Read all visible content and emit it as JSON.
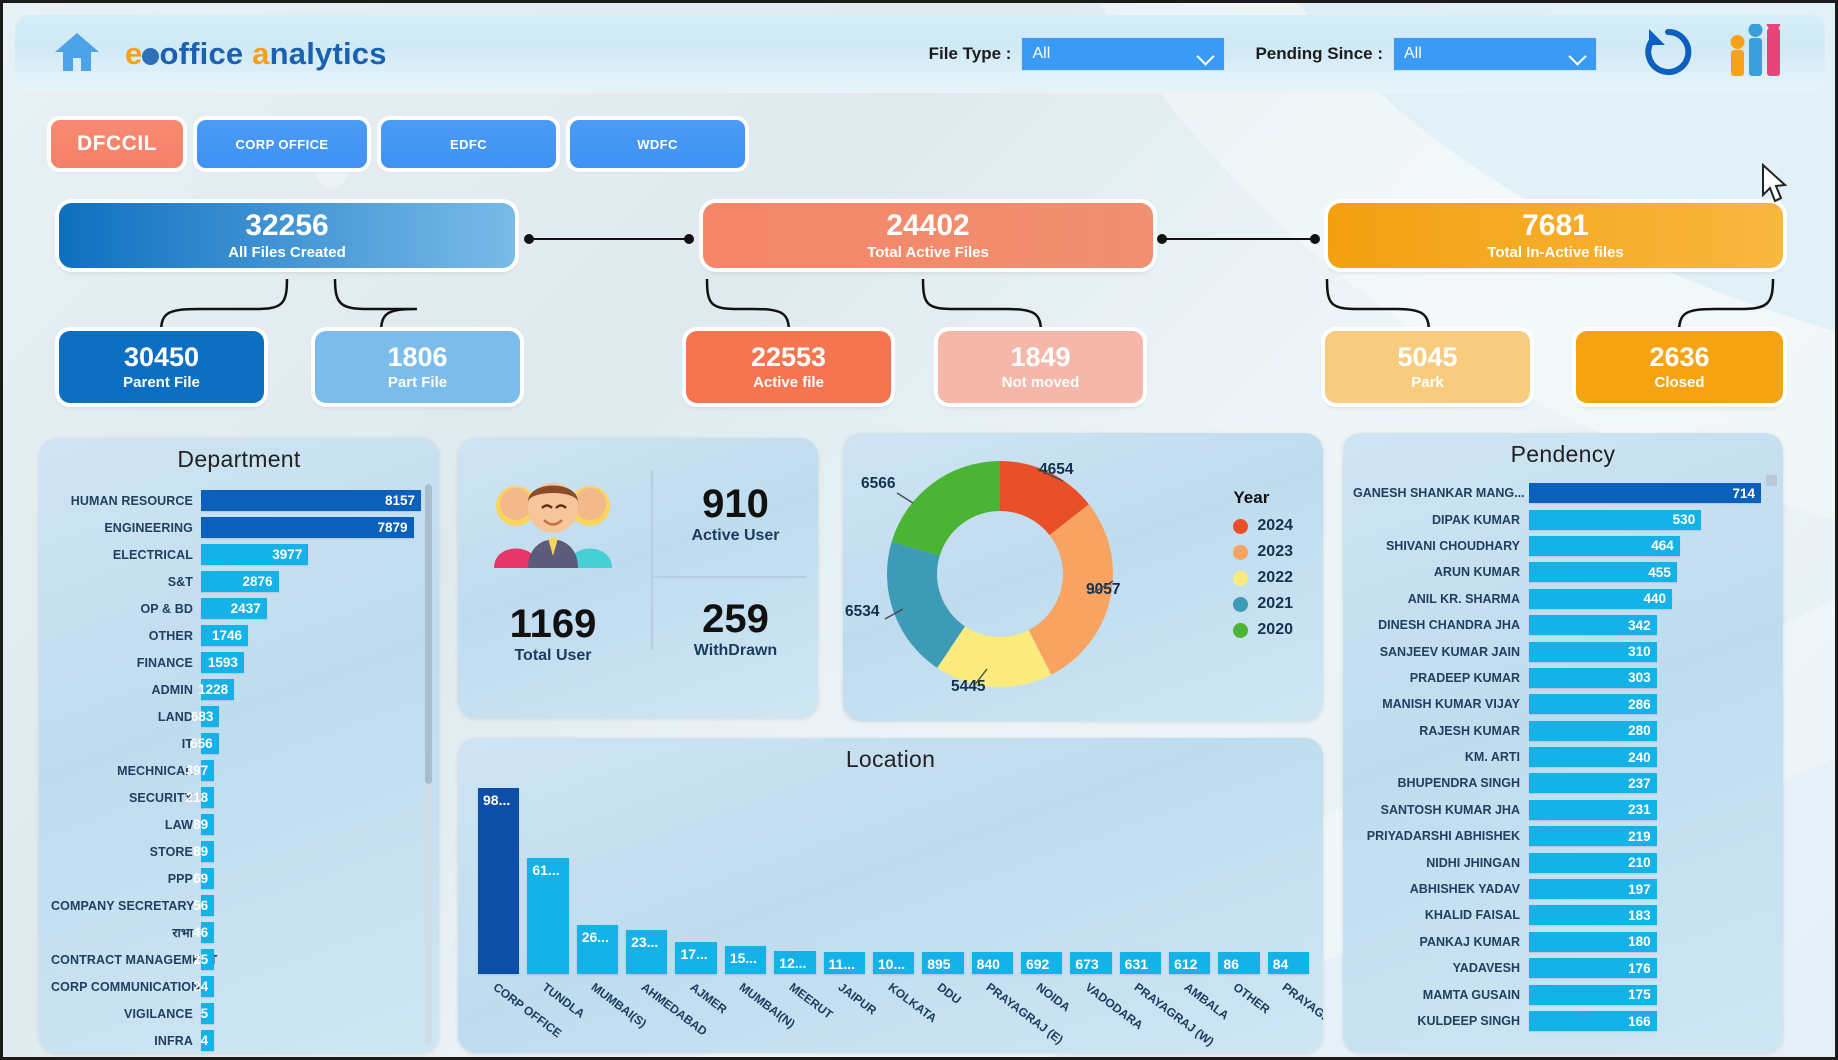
{
  "header": {
    "brand_e": "e",
    "brand_office": "office",
    "brand_a": "a",
    "brand_nalytics": "nalytics",
    "file_type_label": "File Type :",
    "file_type_value": "All",
    "pending_since_label": "Pending Since :",
    "pending_since_value": "All",
    "home_icon": "home-icon",
    "refresh_icon": "refresh-icon",
    "logo_icon": "people-chart-logo"
  },
  "tabs": [
    {
      "label": "DFCCIL",
      "active": true
    },
    {
      "label": "CORP OFFICE",
      "active": false
    },
    {
      "label": "EDFC",
      "active": false
    },
    {
      "label": "WDFC",
      "active": false
    }
  ],
  "kpi_top": [
    {
      "value": "32256",
      "label": "All Files Created"
    },
    {
      "value": "24402",
      "label": "Total Active Files"
    },
    {
      "value": "7681",
      "label": "Total In-Active files"
    }
  ],
  "kpi_sub": [
    {
      "value": "30450",
      "label": "Parent File"
    },
    {
      "value": "1806",
      "label": "Part File"
    },
    {
      "value": "22553",
      "label": "Active file"
    },
    {
      "value": "1849",
      "label": "Not moved"
    },
    {
      "value": "5045",
      "label": "Park"
    },
    {
      "value": "2636",
      "label": "Closed"
    }
  ],
  "department": {
    "title": "Department",
    "chart_data": {
      "type": "bar",
      "title": "Department",
      "orientation": "horizontal",
      "categories": [
        "HUMAN RESOURCE",
        "ENGINEERING",
        "ELECTRICAL",
        "S&T",
        "OP & BD",
        "OTHER",
        "FINANCE",
        "ADMIN",
        "LAND",
        "IT",
        "MECHNICAL",
        "SECURITY",
        "LAW",
        "STORE",
        "PPP",
        "COMPANY SECRETARY",
        "राभा",
        "CONTRACT MANAGEMENT",
        "CORP COMMUNICATION",
        "VIGILANCE",
        "INFRA"
      ],
      "values": [
        8157,
        7879,
        3977,
        2876,
        2437,
        1746,
        1593,
        1228,
        683,
        656,
        397,
        218,
        89,
        89,
        69,
        56,
        46,
        25,
        24,
        5,
        4
      ],
      "xlabel": "",
      "ylabel": "",
      "grid": false,
      "legend": "none"
    }
  },
  "users": {
    "active_user_value": "910",
    "active_user_label": "Active User",
    "total_user_value": "1169",
    "total_user_label": "Total User",
    "withdrawn_value": "259",
    "withdrawn_label": "WithDrawn",
    "avatar_icon": "users-group-icon"
  },
  "donut": {
    "legend_title": "Year",
    "chart_data": {
      "type": "pie",
      "title": "",
      "categories": [
        "2024",
        "2023",
        "2022",
        "2021",
        "2020"
      ],
      "values": [
        4654,
        9057,
        5445,
        6534,
        6566
      ],
      "colors": [
        "#e8502a",
        "#f9a362",
        "#fbeb7d",
        "#3d9bb5",
        "#4bb434"
      ],
      "labels": [
        "4654",
        "9057",
        "5445",
        "6534",
        "6566"
      ],
      "legend": "right",
      "total": 32256
    }
  },
  "location": {
    "title": "Location",
    "chart_data": {
      "type": "bar",
      "title": "Location",
      "orientation": "vertical",
      "categories": [
        "CORP OFFICE",
        "TUNDLA",
        "MUMBAI(S)",
        "AHMEDABAD",
        "AJMER",
        "MUMBAI(N)",
        "MEERUT",
        "JAIPUR",
        "KOLKATA",
        "DDU",
        "PRAYAGRAJ (E)",
        "NOIDA",
        "VADODARA",
        "PRAYAGRAJ (W)",
        "AMBALA",
        "OTHER",
        "PRAYAGRAJ"
      ],
      "values": [
        9800,
        6100,
        2600,
        2300,
        1700,
        1500,
        1200,
        1100,
        1000,
        895,
        840,
        692,
        673,
        631,
        612,
        86,
        84
      ],
      "display_labels": [
        "98...",
        "61...",
        "26...",
        "23...",
        "17...",
        "15...",
        "12...",
        "11...",
        "10...",
        "895",
        "840",
        "692",
        "673",
        "631",
        "612",
        "86",
        "84"
      ],
      "xlabel": "",
      "ylabel": "",
      "grid": false,
      "legend": "none"
    }
  },
  "pendency": {
    "title": "Pendency",
    "chart_data": {
      "type": "bar",
      "title": "Pendency",
      "orientation": "horizontal",
      "categories": [
        "GANESH SHANKAR MANG...",
        "DIPAK KUMAR",
        "SHIVANI CHOUDHARY",
        "ARUN KUMAR",
        "ANIL KR. SHARMA",
        "DINESH CHANDRA JHA",
        "SANJEEV KUMAR JAIN",
        "PRADEEP KUMAR",
        "MANISH KUMAR VIJAY",
        "RAJESH KUMAR",
        "KM. ARTI",
        "BHUPENDRA SINGH",
        "SANTOSH KUMAR JHA",
        "PRIYADARSHI ABHISHEK",
        "NIDHI JHINGAN",
        "ABHISHEK YADAV",
        "KHALID FAISAL",
        "PANKAJ KUMAR",
        "YADAVESH",
        "MAMTA GUSAIN",
        "KULDEEP SINGH"
      ],
      "values": [
        714,
        530,
        464,
        455,
        440,
        342,
        310,
        303,
        286,
        280,
        240,
        237,
        231,
        219,
        210,
        197,
        183,
        180,
        176,
        175,
        166
      ],
      "xlabel": "",
      "ylabel": "",
      "grid": false,
      "legend": "none"
    }
  },
  "colors": {
    "accent_blue": "#15b2e8",
    "dark_blue": "#0a60bb",
    "orange": "#f5a310",
    "salmon": "#f5806a"
  }
}
